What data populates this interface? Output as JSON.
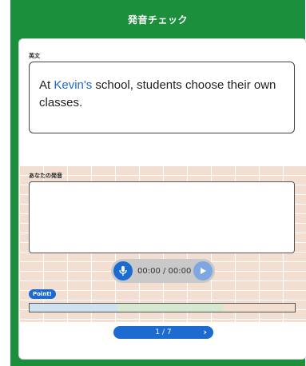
{
  "header": {
    "title": "発音チェック"
  },
  "english": {
    "label": "英文",
    "sentence_prefix": "At ",
    "sentence_name": "Kevin's",
    "sentence_suffix": " school, students choose their own classes."
  },
  "pronunciation": {
    "label": "あなたの発音",
    "value": ""
  },
  "player": {
    "time": "00:00 / 00:00",
    "mic_icon": "microphone-icon",
    "play_icon": "play-icon"
  },
  "point": {
    "label": "Point!"
  },
  "score_bar": {
    "segments": [
      {
        "color": "#cfe0ee",
        "share": 0.33
      },
      {
        "color": "#d6e9d0",
        "share": 0.4
      },
      {
        "color": "#f2dfcf",
        "share": 0.27
      }
    ]
  },
  "navigation": {
    "page": "1 / 7",
    "next_icon": "chevron-right-icon"
  },
  "colors": {
    "brand_green": "#1b8f3b",
    "accent_blue": "#1b6bd0"
  }
}
